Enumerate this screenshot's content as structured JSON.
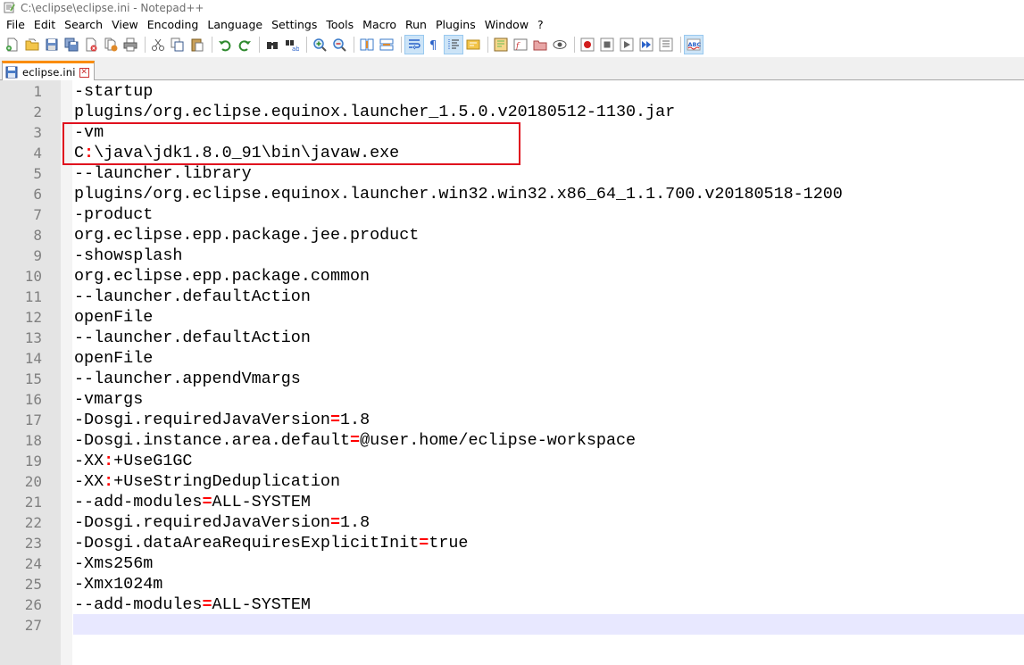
{
  "window": {
    "title": "C:\\eclipse\\eclipse.ini - Notepad++"
  },
  "menu": [
    "File",
    "Edit",
    "Search",
    "View",
    "Encoding",
    "Language",
    "Settings",
    "Tools",
    "Macro",
    "Run",
    "Plugins",
    "Window",
    "?"
  ],
  "toolbar": {
    "icons": [
      "new-file-icon",
      "open-file-icon",
      "save-icon",
      "save-all-icon",
      "close-icon",
      "close-all-icon",
      "print-icon",
      "cut-icon",
      "copy-icon",
      "paste-icon",
      "undo-icon",
      "redo-icon",
      "find-icon",
      "replace-icon",
      "zoom-in-icon",
      "zoom-out-icon",
      "sync-vertical-icon",
      "sync-horizontal-icon",
      "word-wrap-icon",
      "show-all-chars-icon",
      "indent-guide-icon",
      "udl-icon",
      "doc-map-icon",
      "function-list-icon",
      "folder-workspace-icon",
      "monitor-icon",
      "record-macro-icon",
      "stop-macro-icon",
      "play-macro-icon",
      "run-macro-multiple-icon",
      "save-macro-icon",
      "spell-check-icon"
    ]
  },
  "tabs": [
    {
      "label": "eclipse.ini",
      "active": true
    }
  ],
  "editor": {
    "lines": [
      "-startup",
      "plugins/org.eclipse.equinox.launcher_1.5.0.v20180512-1130.jar",
      "-vm",
      "C:\\java\\jdk1.8.0_91\\bin\\javaw.exe",
      "--launcher.library",
      "plugins/org.eclipse.equinox.launcher.win32.win32.x86_64_1.1.700.v20180518-1200",
      "-product",
      "org.eclipse.epp.package.jee.product",
      "-showsplash",
      "org.eclipse.epp.package.common",
      "--launcher.defaultAction",
      "openFile",
      "--launcher.defaultAction",
      "openFile",
      "--launcher.appendVmargs",
      "-vmargs",
      "-Dosgi.requiredJavaVersion=1.8",
      "-Dosgi.instance.area.default=@user.home/eclipse-workspace",
      "-XX:+UseG1GC",
      "-XX:+UseStringDeduplication",
      "--add-modules=ALL-SYSTEM",
      "-Dosgi.requiredJavaVersion=1.8",
      "-Dosgi.dataAreaRequiresExplicitInit=true",
      "-Xms256m",
      "-Xmx1024m",
      "--add-modules=ALL-SYSTEM",
      ""
    ],
    "current_line": 27
  },
  "colors": {
    "operator": "#ff0000",
    "highlight_box": "#e0101e",
    "tab_accent": "#fa8c00",
    "caret_line": "#e8e8ff"
  }
}
